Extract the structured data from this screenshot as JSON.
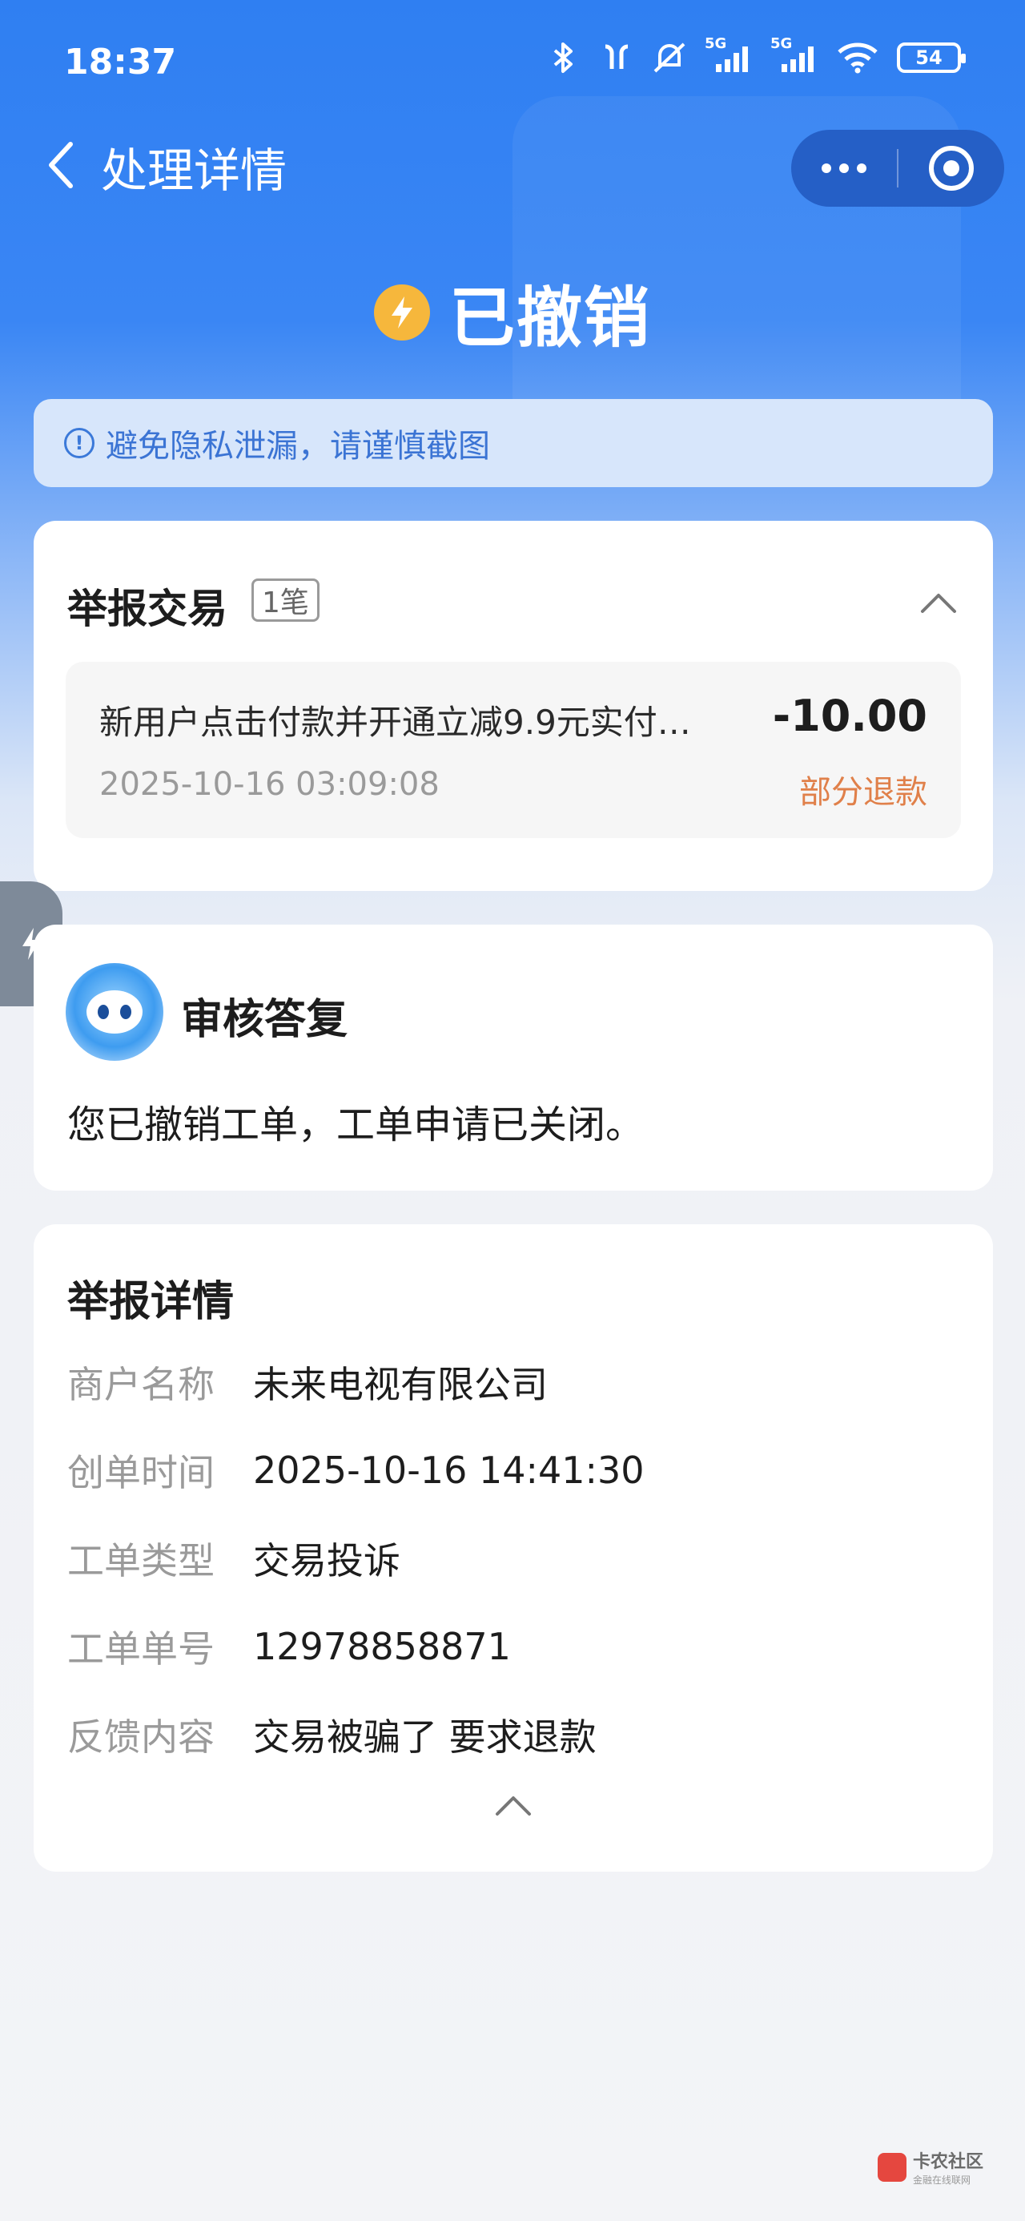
{
  "status_bar": {
    "time": "18:37",
    "network_label_1": "5G",
    "network_label_2": "5G",
    "battery": "54"
  },
  "nav": {
    "title": "处理详情"
  },
  "state": {
    "text": "已撤销"
  },
  "tip": {
    "icon_text": "!",
    "text": "避免隐私泄漏，请谨慎截图"
  },
  "report_transactions": {
    "title": "举报交易",
    "count_badge": "1笔",
    "transaction": {
      "name": "新用户点击付款并开通立减9.9元实付…",
      "amount": "-10.00",
      "time": "2025-10-16 03:09:08",
      "status": "部分退款"
    }
  },
  "review_reply": {
    "title": "审核答复",
    "body": "您已撤销工单，工单申请已关闭。"
  },
  "report_details": {
    "title": "举报详情",
    "rows": [
      {
        "label": "商户名称",
        "value": "未来电视有限公司"
      },
      {
        "label": "创单时间",
        "value": "2025-10-16 14:41:30"
      },
      {
        "label": "工单类型",
        "value": "交易投诉"
      },
      {
        "label": "工单单号",
        "value": "12978858871"
      },
      {
        "label": "反馈内容",
        "value": "交易被骗了 要求退款"
      }
    ]
  },
  "watermark": {
    "name": "卡农社区",
    "sub": "金融在线联网"
  },
  "colors": {
    "primary_blue": "#3a86f4",
    "refund_orange": "#e0804a",
    "state_icon_yellow": "#f6b73c",
    "tip_bg": "#d7e6fb"
  }
}
